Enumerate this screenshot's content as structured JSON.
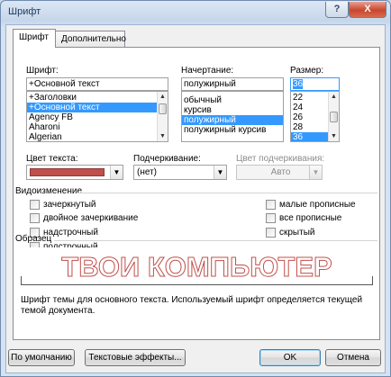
{
  "window": {
    "title": "Шрифт",
    "help_label": "?",
    "close_label": "X"
  },
  "tabs": [
    {
      "label": "Шрифт",
      "active": true
    },
    {
      "label": "Дополнительно",
      "active": false
    }
  ],
  "font": {
    "label": "Шрифт:",
    "value": "+Основной текст",
    "items": [
      "+Заголовки",
      "+Основной текст",
      "Agency FB",
      "Aharoni",
      "Algerian"
    ],
    "selected_index": 1
  },
  "style": {
    "label": "Начертание:",
    "value": "полужирный",
    "items": [
      "обычный",
      "курсив",
      "полужирный",
      "полужирный курсив"
    ],
    "selected_index": 2
  },
  "size": {
    "label": "Размер:",
    "value": "36",
    "items": [
      "22",
      "24",
      "26",
      "28",
      "36"
    ],
    "selected_index": 4
  },
  "font_color": {
    "label": "Цвет текста:",
    "color": "#c0504d"
  },
  "underline": {
    "label": "Подчеркивание:",
    "value": "(нет)"
  },
  "underline_color": {
    "label": "Цвет подчеркивания:",
    "value": "Авто",
    "enabled": false
  },
  "effects": {
    "title": "Видоизменение",
    "items": [
      {
        "label": "зачеркнутый",
        "checked": false
      },
      {
        "label": "двойное зачеркивание",
        "checked": false
      },
      {
        "label": "надстрочный",
        "checked": false
      },
      {
        "label": "подстрочный",
        "checked": false
      },
      {
        "label": "малые прописные",
        "checked": false
      },
      {
        "label": "все прописные",
        "checked": false
      },
      {
        "label": "скрытый",
        "checked": false
      }
    ]
  },
  "preview": {
    "title": "Образец",
    "text": "ТВОИ КОМПЬЮТЕР",
    "description": "Шрифт темы для основного текста. Используемый шрифт определяется текущей темой документа."
  },
  "buttons": {
    "default": "По умолчанию",
    "text_effects": "Текстовые эффекты...",
    "ok": "OK",
    "cancel": "Отмена"
  },
  "colors": {
    "accent": "#3399ff",
    "font_color": "#c0504d"
  }
}
